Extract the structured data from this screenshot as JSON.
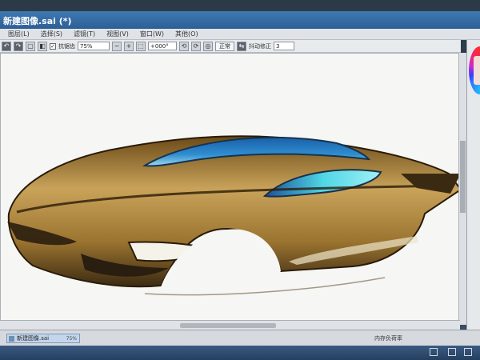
{
  "window": {
    "title": "新建图像.sai (*)"
  },
  "menu": {
    "items": [
      "图层(L)",
      "选择(S)",
      "滤镜(T)",
      "视图(V)",
      "窗口(W)",
      "其他(O)"
    ]
  },
  "toolbar": {
    "antialias_label": "抗锯齿",
    "zoom_value": "75%",
    "rotation_value": "+000°",
    "blend_mode": "正常",
    "stabilizer_label": "抖动修正",
    "stabilizer_value": "3"
  },
  "status": {
    "document_tab": "新建图像.sai",
    "document_zoom": "75%",
    "memory_label": "内存负荷率"
  },
  "colors": {
    "car_gold": "#b58a3a",
    "car_dark": "#3b2a12",
    "glass_blue": "#1f6fb5",
    "glass_cyan": "#4fd6e6"
  }
}
